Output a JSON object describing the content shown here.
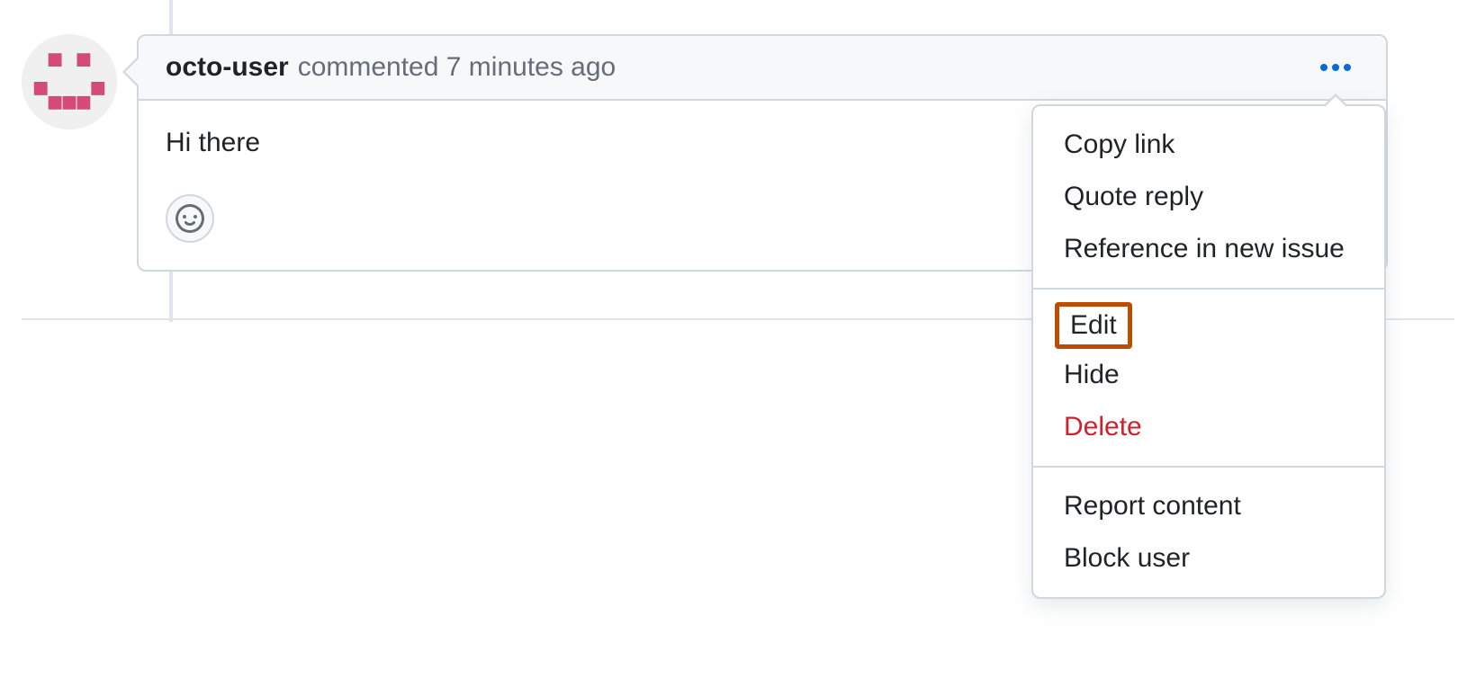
{
  "comment": {
    "username": "octo-user",
    "action": "commented",
    "timestamp": "7 minutes ago",
    "body": "Hi there"
  },
  "menu": {
    "section1": {
      "copy_link": "Copy link",
      "quote_reply": "Quote reply",
      "reference": "Reference in new issue"
    },
    "section2": {
      "edit": "Edit",
      "hide": "Hide",
      "delete": "Delete"
    },
    "section3": {
      "report": "Report content",
      "block": "Block user"
    }
  }
}
